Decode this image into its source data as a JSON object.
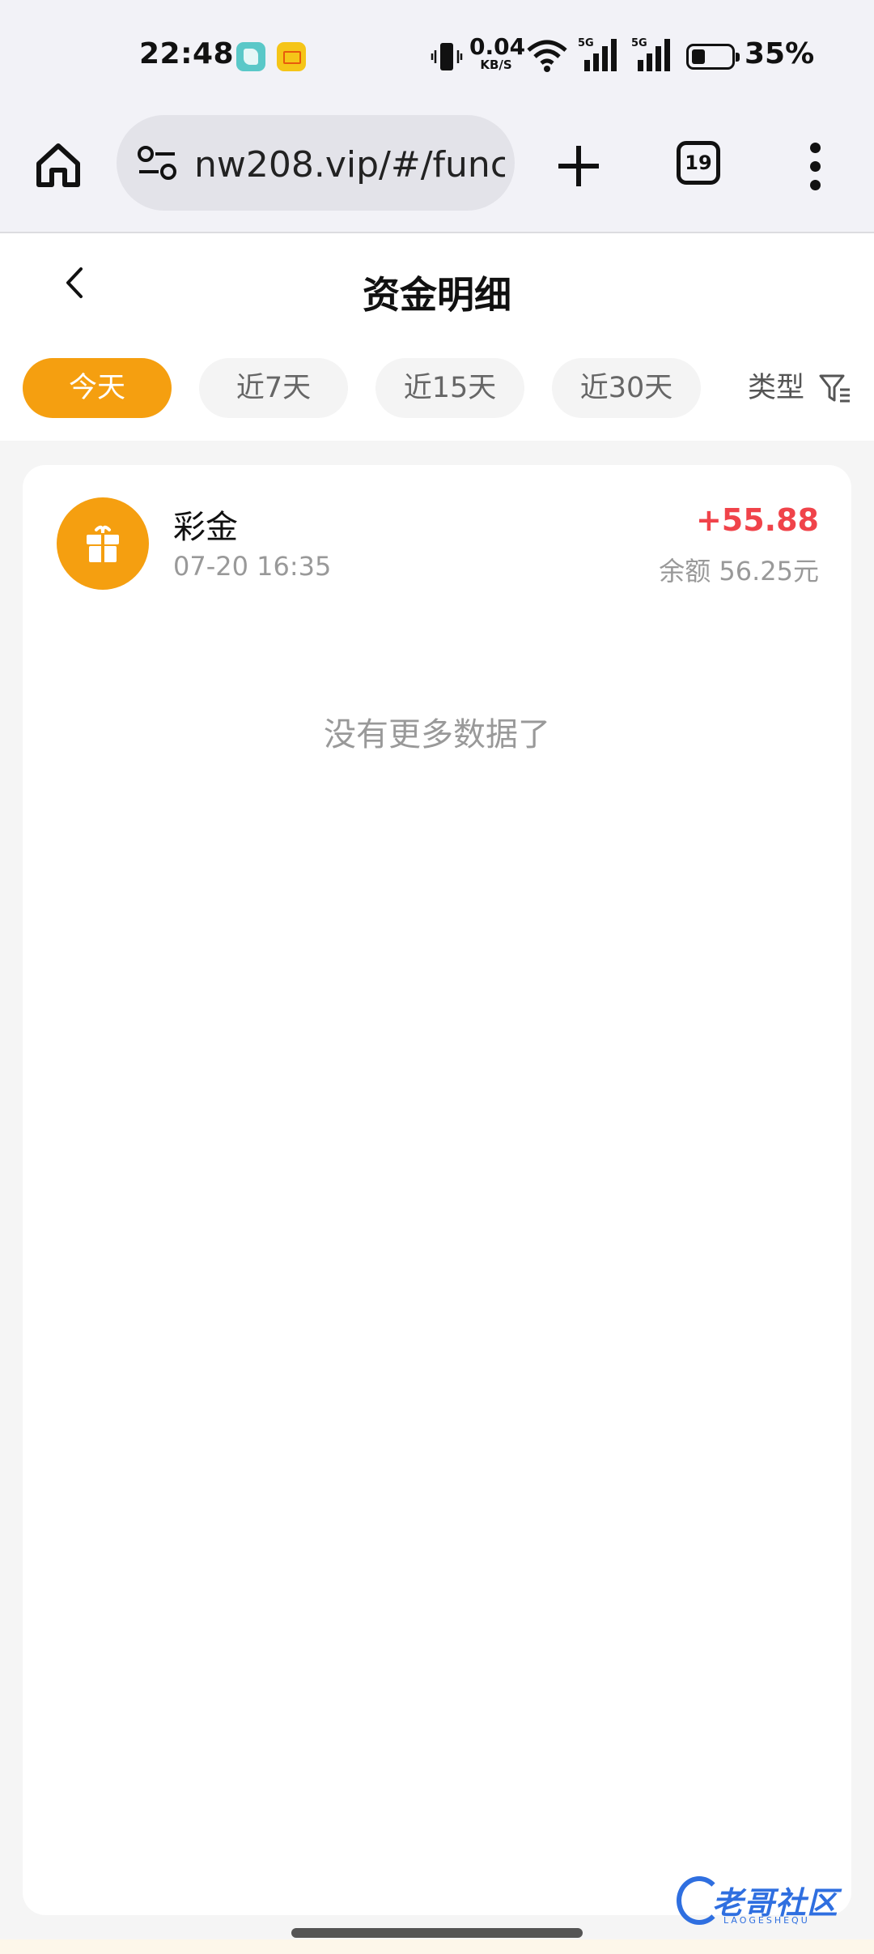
{
  "status_bar": {
    "time": "22:48",
    "net_speed_value": "0.04",
    "net_speed_unit": "KB/S",
    "signal_1_label": "5G",
    "signal_2_label": "5G",
    "battery_percent": "35%",
    "battery_level": 0.35
  },
  "browser": {
    "url": "nw208.vip/#/func",
    "tab_count": "19"
  },
  "page": {
    "title": "资金明细",
    "filters": [
      {
        "label": "今天",
        "active": true
      },
      {
        "label": "近7天",
        "active": false
      },
      {
        "label": "近15天",
        "active": false
      },
      {
        "label": "近30天",
        "active": false
      }
    ],
    "type_filter_label": "类型"
  },
  "records": [
    {
      "type": "彩金",
      "time": "07-20 16:35",
      "amount": "+55.88",
      "balance": "余额 56.25元",
      "icon": "gift-icon"
    }
  ],
  "empty_text": "没有更多数据了",
  "watermark": {
    "text": "老哥社区",
    "subtext": "LAOGESHEQU"
  },
  "colors": {
    "accent": "#f59f10",
    "amount_positive": "#f0434a"
  }
}
